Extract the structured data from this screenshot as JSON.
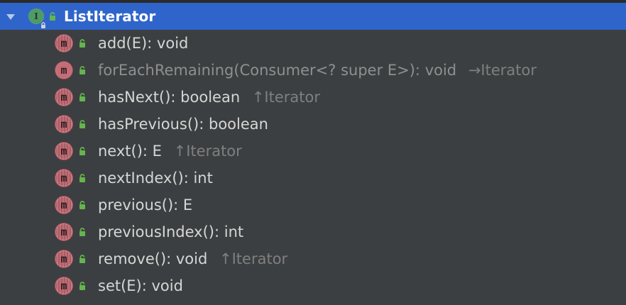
{
  "header": {
    "title": "ListIterator",
    "icon_name": "interface-icon",
    "lock_icon_name": "public-lock-icon",
    "arrow_icon_name": "collapse-arrow-icon",
    "colors": {
      "selection": "#2f65ca",
      "background": "#3c3f41",
      "method_icon": "#c46d76",
      "public_icon": "#5fb14b",
      "primary_text": "#d6d6d6",
      "secondary_text": "#7f7f7f"
    }
  },
  "members": [
    {
      "name": "add(E): void",
      "owner": "",
      "icon": "method-icon",
      "lock_icon": "public-lock-icon"
    },
    {
      "name": "forEachRemaining(Consumer<? super E>): void",
      "owner": "→Iterator",
      "icon": "method-icon",
      "lock_icon": "public-lock-icon"
    },
    {
      "name": "hasNext(): boolean",
      "owner": "↑Iterator",
      "icon": "method-icon",
      "lock_icon": "public-lock-icon"
    },
    {
      "name": "hasPrevious(): boolean",
      "owner": "",
      "icon": "method-icon",
      "lock_icon": "public-lock-icon"
    },
    {
      "name": "next(): E",
      "owner": "↑Iterator",
      "icon": "method-icon",
      "lock_icon": "public-lock-icon"
    },
    {
      "name": "nextIndex(): int",
      "owner": "",
      "icon": "method-icon",
      "lock_icon": "public-lock-icon"
    },
    {
      "name": "previous(): E",
      "owner": "",
      "icon": "method-icon",
      "lock_icon": "public-lock-icon"
    },
    {
      "name": "previousIndex(): int",
      "owner": "",
      "icon": "method-icon",
      "lock_icon": "public-lock-icon"
    },
    {
      "name": "remove(): void",
      "owner": "↑Iterator",
      "icon": "method-icon",
      "lock_icon": "public-lock-icon"
    },
    {
      "name": "set(E): void",
      "owner": "",
      "icon": "method-icon",
      "lock_icon": "public-lock-icon"
    }
  ]
}
